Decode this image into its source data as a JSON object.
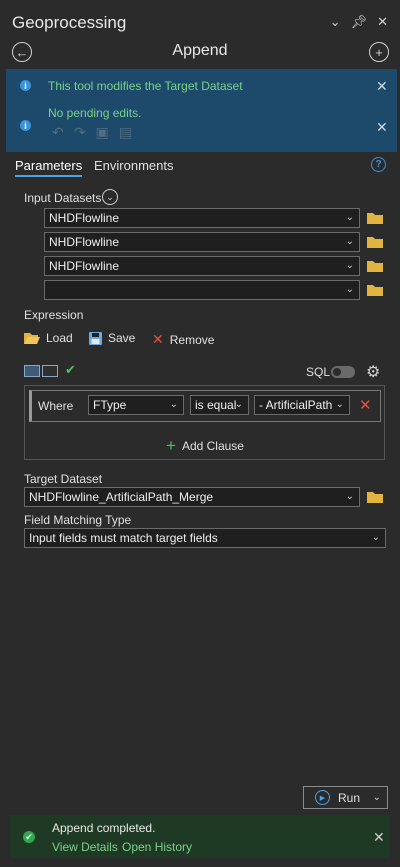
{
  "window": {
    "title": "Geoprocessing",
    "tool_name": "Append",
    "controls": [
      "chevron-down-icon",
      "pin-icon",
      "close-icon"
    ]
  },
  "banner": {
    "message1": "This tool modifies the Target Dataset",
    "message2": "No pending edits."
  },
  "tabs": {
    "parameters": "Parameters",
    "environments": "Environments"
  },
  "input_datasets": {
    "label": "Input Datasets",
    "items": [
      "NHDFlowline",
      "NHDFlowline",
      "NHDFlowline",
      ""
    ]
  },
  "expression": {
    "label": "Expression",
    "load": "Load",
    "save": "Save",
    "remove": "Remove",
    "sql": "SQL",
    "sql_enabled": false,
    "where": "Where",
    "field": "FType",
    "operator": "is equal",
    "value": "- ArtificialPath",
    "add_clause": "Add Clause"
  },
  "target_dataset": {
    "label": "Target Dataset",
    "value": "NHDFlowline_ArtificialPath_Merge"
  },
  "field_matching": {
    "label": "Field Matching Type",
    "value": "Input fields must match target fields"
  },
  "run": {
    "label": "Run"
  },
  "status": {
    "message": "Append completed.",
    "view_details": "View Details",
    "open_history": "Open History"
  },
  "colors": {
    "background": "#2b2b2b",
    "banner": "#1d4a6b",
    "success_text": "#7bd08a",
    "accent": "#3a93d8",
    "status_bg": "#1f3a24"
  }
}
